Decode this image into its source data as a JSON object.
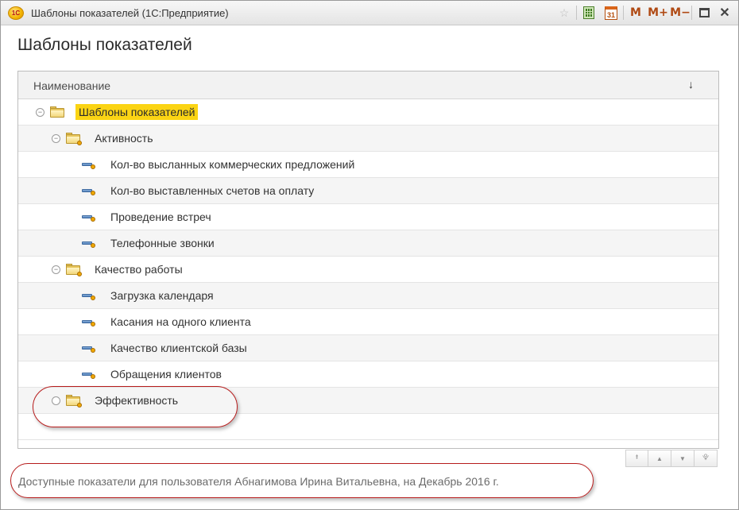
{
  "window": {
    "app_logo_text": "1С",
    "title": "Шаблоны показателей (1С:Предприятие)",
    "toolbar": {
      "star_icon": "star-icon",
      "calculator_icon": "calculator-icon",
      "calendar_label": "31",
      "m_label": "M",
      "mplus_label": "M+",
      "mminus_label": "M−",
      "close_label": "✕"
    }
  },
  "page": {
    "title": "Шаблоны показателей"
  },
  "tree": {
    "column_header": "Наименование",
    "sort_indicator": "↓",
    "rows": [
      {
        "label": "Шаблоны показателей",
        "type": "group",
        "level": 0,
        "state": "expanded",
        "selected": true
      },
      {
        "label": "Активность",
        "type": "group",
        "level": 1,
        "state": "expanded"
      },
      {
        "label": "Кол-во высланных коммерческих предложений",
        "type": "item",
        "level": 2
      },
      {
        "label": "Кол-во выставленных счетов на оплату",
        "type": "item",
        "level": 2
      },
      {
        "label": "Проведение встреч",
        "type": "item",
        "level": 2
      },
      {
        "label": "Телефонные звонки",
        "type": "item",
        "level": 2
      },
      {
        "label": "Качество работы",
        "type": "group",
        "level": 1,
        "state": "expanded"
      },
      {
        "label": "Загрузка календаря",
        "type": "item",
        "level": 2
      },
      {
        "label": "Касания на одного клиента",
        "type": "item",
        "level": 2
      },
      {
        "label": "Качество клиентской базы",
        "type": "item",
        "level": 2
      },
      {
        "label": "Обращения клиентов",
        "type": "item",
        "level": 2
      },
      {
        "label": "Эффективность",
        "type": "group",
        "level": 1,
        "state": "empty"
      }
    ]
  },
  "navigation": {
    "first_label": "⯒",
    "prev_label": "▲",
    "next_label": "▼",
    "last_label": "⯓"
  },
  "status": {
    "text": "Доступные показатели для пользователя Абнагимова Ирина Витальевна, на Декабрь 2016 г."
  },
  "colors": {
    "selection": "#fbd414",
    "annotation_oval": "#b71c1c",
    "header_bg": "#f2f2f2"
  }
}
